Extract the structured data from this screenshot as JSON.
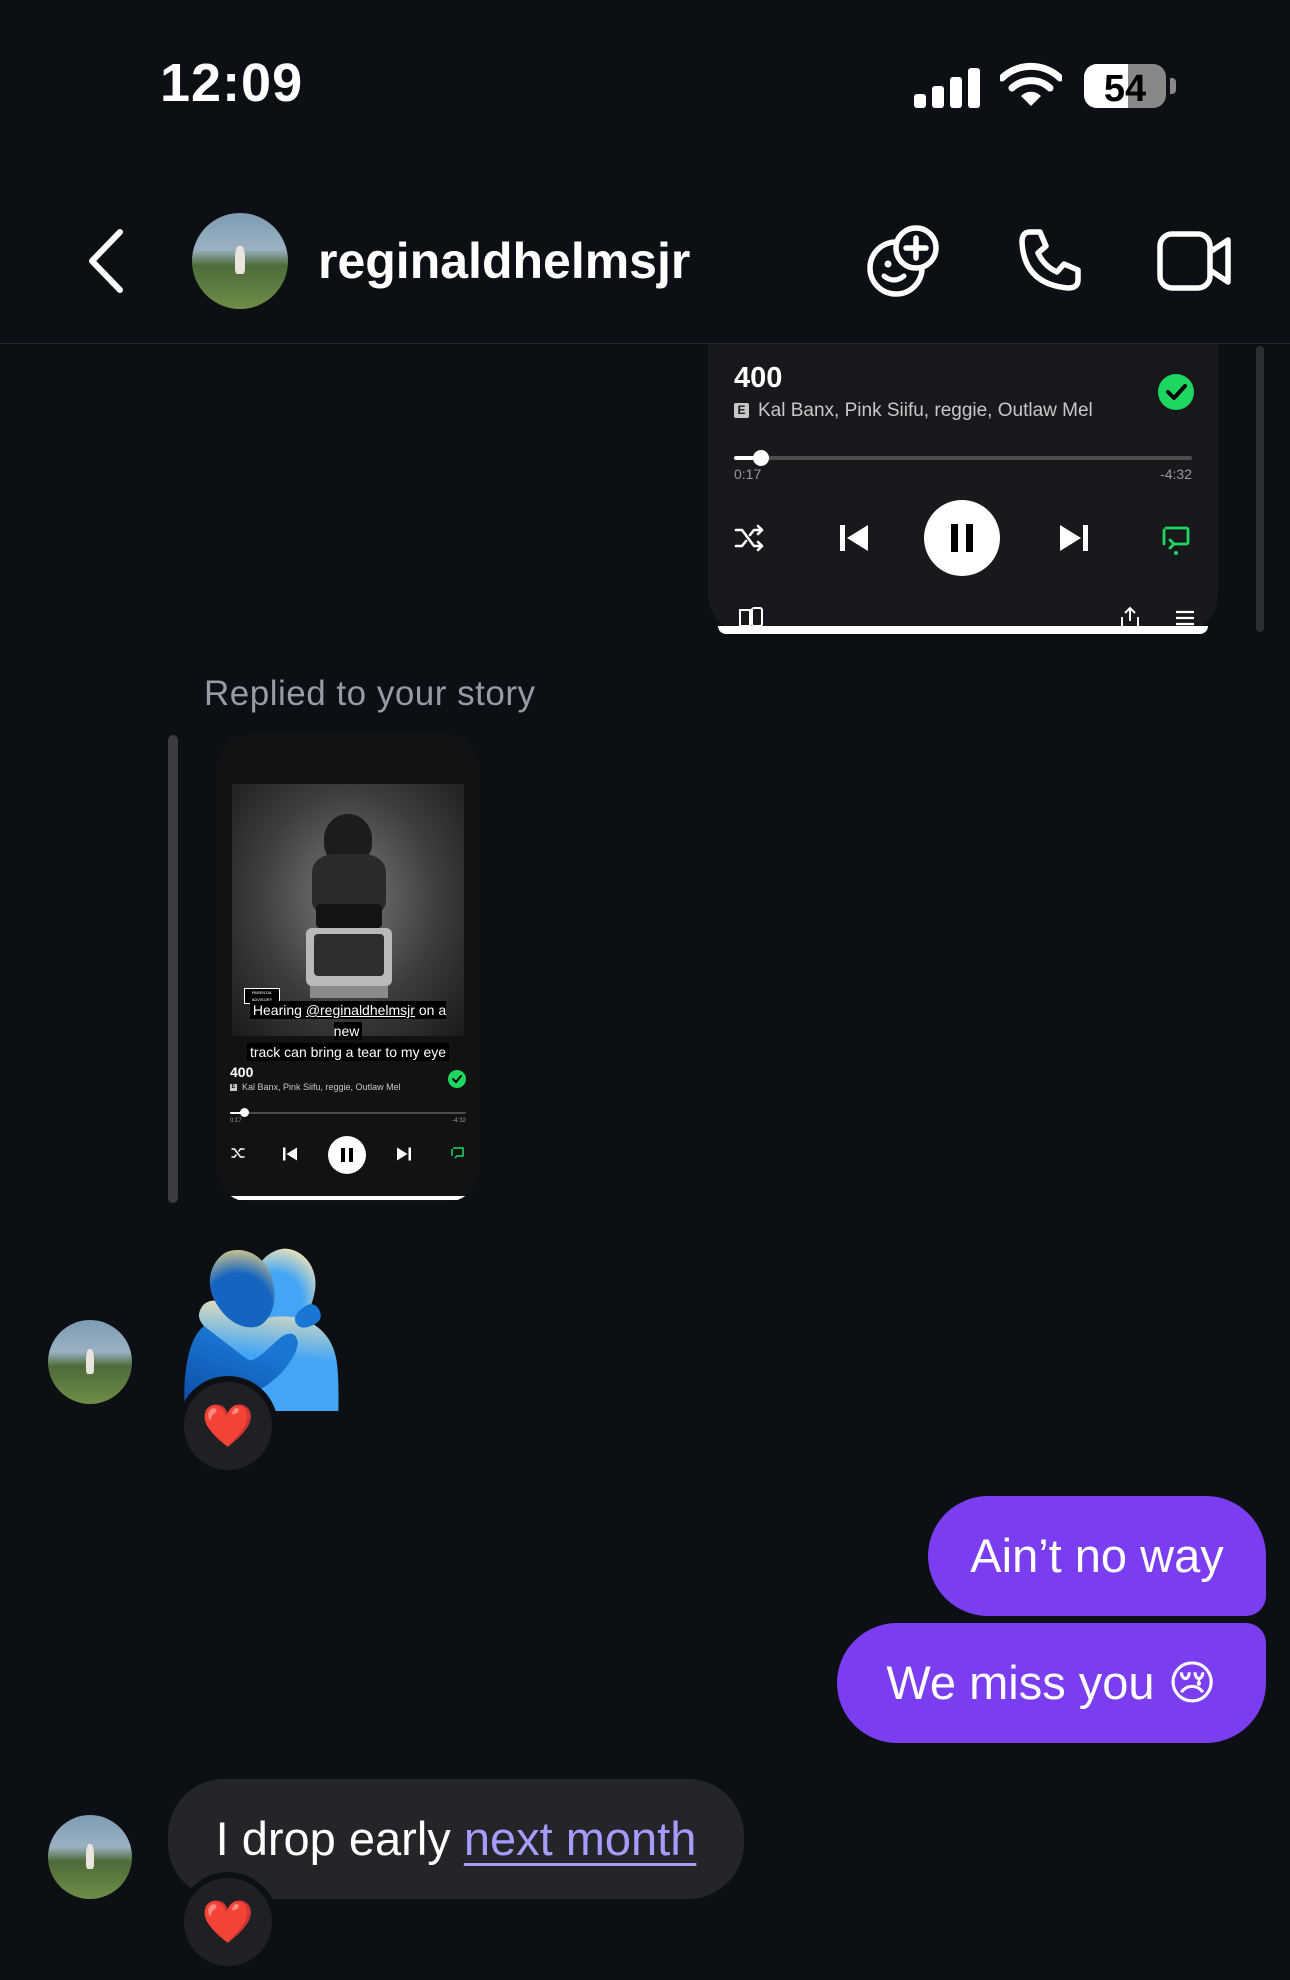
{
  "status_bar": {
    "time": "12:09",
    "battery": "54",
    "battery_level": 0.54
  },
  "header": {
    "username": "reginaldhelmsjr"
  },
  "track_card": {
    "title": "400",
    "explicit_badge": "E",
    "artists": "Kal Banx, Pink Siifu, reggie, Outlaw Mel",
    "elapsed": "0:17",
    "remaining": "-4:32",
    "progress": 0.06
  },
  "story_reply": {
    "label": "Replied to your story",
    "advisory": "PARENTAL ADVISORY",
    "caption_prefix": "Hearing ",
    "caption_mention": "@reginaldhelmsjr",
    "caption_mid": " on a new",
    "caption_line2": "track can bring a tear to my eye",
    "title": "400",
    "explicit_badge": "E",
    "artists": "Kal Banx, Pink Siifu, reggie, Outlaw Mel",
    "elapsed": "0:17",
    "remaining": "-4:32"
  },
  "messages": {
    "hug_emoji": "🫂",
    "hug_reaction": "❤️",
    "out_1": "Ain’t no way",
    "out_2_text": "We miss you ",
    "out_2_emoji": "😢",
    "in_1_text": "I drop early ",
    "in_1_link": "next month",
    "in_1_reaction": "❤️"
  },
  "colors": {
    "background": "#0c0f14",
    "outgoing_bubble": "#7b3df0",
    "incoming_bubble": "#232529",
    "spotify_green": "#1ed760",
    "link": "#a79bff"
  },
  "icons": [
    "back-chevron-icon",
    "signal-icon",
    "wifi-icon",
    "battery-icon",
    "add-effect-icon",
    "phone-icon",
    "video-icon",
    "shuffle-icon",
    "previous-icon",
    "pause-icon",
    "next-icon",
    "repeat-icon",
    "devices-icon",
    "share-icon",
    "queue-icon",
    "check-icon"
  ]
}
